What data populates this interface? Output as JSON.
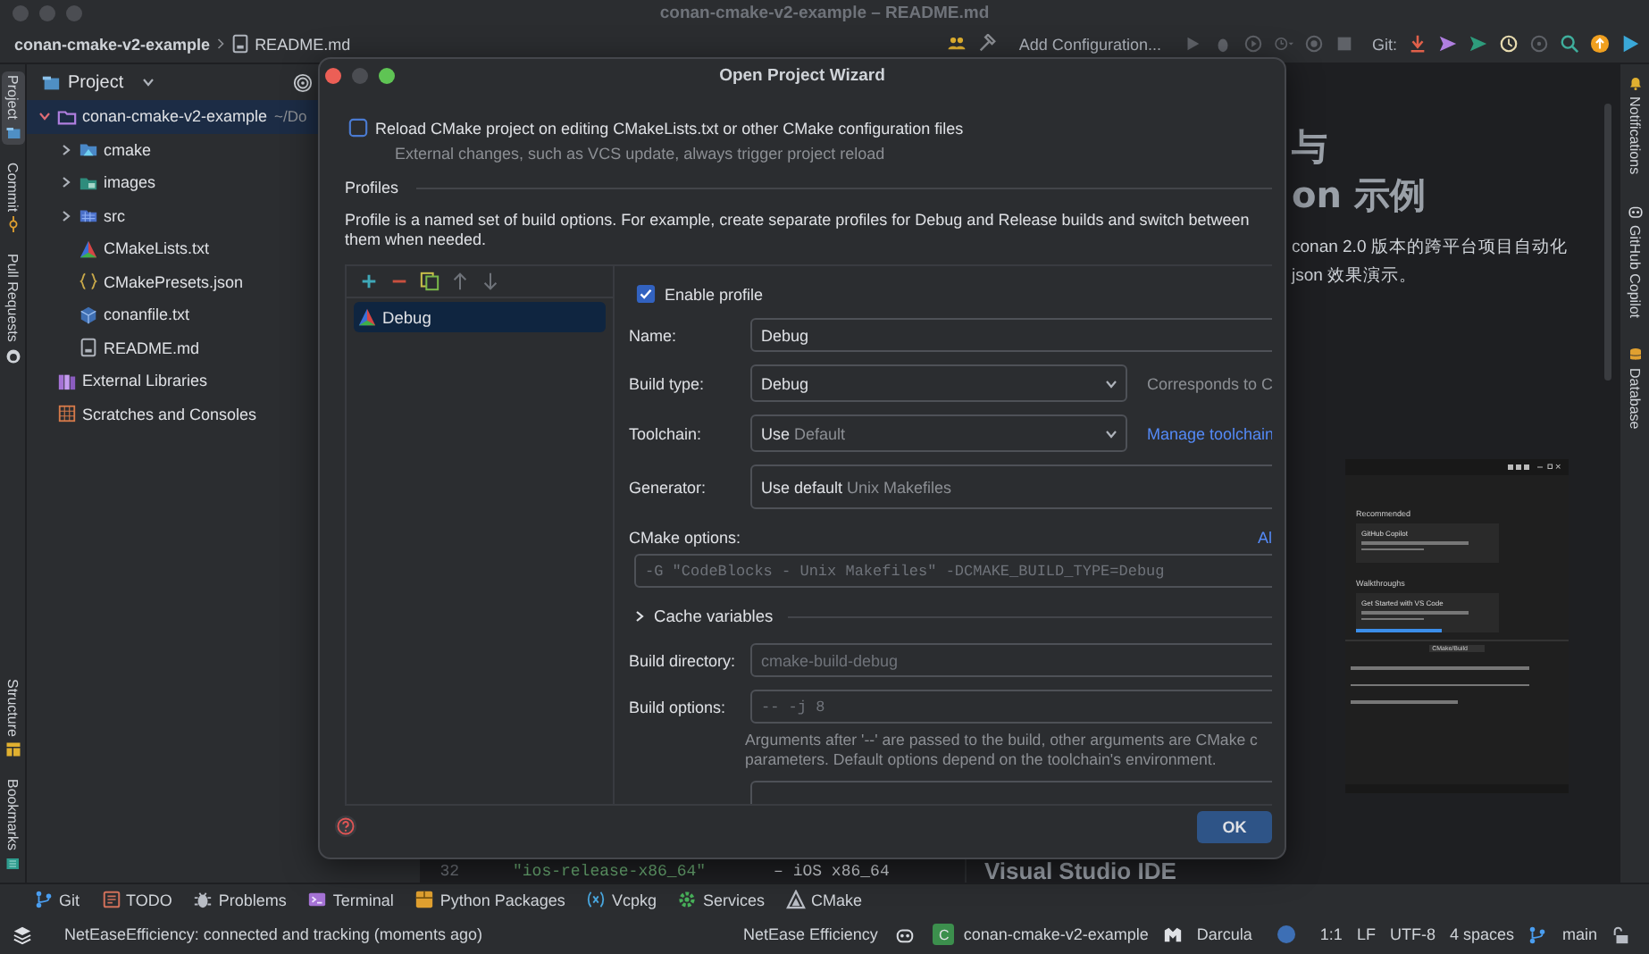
{
  "window": {
    "title": "conan-cmake-v2-example – README.md"
  },
  "breadcrumb": [
    {
      "label": "conan-cmake-v2-example",
      "kind": "project"
    },
    {
      "label": "README.md",
      "kind": "markdown"
    }
  ],
  "toolbar": {
    "run_config": "Add Configuration...",
    "git_label": "Git:"
  },
  "left_strip": [
    {
      "label": "Project",
      "kind": "project",
      "selected": true
    },
    {
      "label": "Commit",
      "kind": "commit",
      "selected": false
    },
    {
      "label": "Pull Requests",
      "kind": "github",
      "selected": false
    }
  ],
  "left_strip_bottom": [
    {
      "label": "Structure",
      "kind": "structure"
    },
    {
      "label": "Bookmarks",
      "kind": "bookmarks"
    }
  ],
  "right_strip": [
    {
      "label": "Notifications",
      "kind": "bell"
    },
    {
      "label": "GitHub Copilot",
      "kind": "copilot"
    },
    {
      "label": "Database",
      "kind": "database"
    }
  ],
  "project_panel": {
    "title": "Project",
    "tree": [
      {
        "label": "conan-cmake-v2-example",
        "detail": "~/Do",
        "kind": "root",
        "expanded": true,
        "selected": true,
        "children": [
          {
            "label": "cmake",
            "kind": "folder",
            "expanded": false,
            "selected": false
          },
          {
            "label": "images",
            "kind": "images",
            "expanded": false,
            "selected": false
          },
          {
            "label": "src",
            "kind": "source",
            "expanded": false,
            "selected": false
          },
          {
            "label": "CMakeLists.txt",
            "kind": "cmake",
            "selected": false
          },
          {
            "label": "CMakePresets.json",
            "kind": "json",
            "selected": false
          },
          {
            "label": "conanfile.txt",
            "kind": "text",
            "selected": false
          },
          {
            "label": "README.md",
            "kind": "markdown",
            "selected": false
          }
        ]
      },
      {
        "label": "External Libraries",
        "kind": "library",
        "selected": false
      },
      {
        "label": "Scratches and Consoles",
        "kind": "scratch",
        "selected": false
      }
    ]
  },
  "editor": {
    "code_line": {
      "number": "32",
      "code": "\"ios-release-x86_64\"",
      "comment": "– iOS x86_64"
    },
    "preview": {
      "heading_lines": [
        "与",
        "on 示例"
      ],
      "paragraph_lines": [
        "conan 2.0 版本的跨平台项目自动化",
        "json 效果演示。"
      ],
      "screenshot": {
        "sections": [
          {
            "title": "Recommended",
            "card": "GitHub Copilot"
          },
          {
            "title": "Walkthroughs",
            "card": "Get Started with VS Code"
          }
        ],
        "panel_dropdown": "CMake/Build"
      },
      "heading_below": "Visual Studio IDE"
    }
  },
  "dialog": {
    "title": "Open Project Wizard",
    "reload_option": {
      "label": "Reload CMake project on editing CMakeLists.txt or other CMake configuration files",
      "checked": false
    },
    "reload_hint": "External changes, such as VCS update, always trigger project reload",
    "section_title": "Profiles",
    "description": "Profile is a named set of build options. For example, create separate profiles for Debug and Release builds and switch between them when needed.",
    "profiles": [
      {
        "name": "Debug",
        "selected": true
      }
    ],
    "enable_profile": {
      "label": "Enable profile",
      "checked": true
    },
    "fields": [
      {
        "kind": "input",
        "label": "Name:",
        "value": "Debug"
      },
      {
        "kind": "select",
        "label": "Build type:",
        "value": "Debug",
        "note": "Corresponds to C"
      },
      {
        "kind": "select",
        "label": "Toolchain:",
        "value": "Use",
        "hint": "Default",
        "link": "Manage toolchain"
      },
      {
        "kind": "static",
        "label": "Generator:",
        "value": "Use default",
        "hint": "Unix Makefiles"
      },
      {
        "kind": "stacked",
        "label": "CMake options:",
        "link": "Al",
        "placeholder": "-G \"CodeBlocks - Unix Makefiles\" -DCMAKE_BUILD_TYPE=Debug"
      },
      {
        "kind": "expander",
        "label": "Cache variables",
        "expanded": false
      },
      {
        "kind": "input",
        "label": "Build directory:",
        "placeholder": "cmake-build-debug"
      },
      {
        "kind": "input",
        "label": "Build options:",
        "placeholder": "-- -j 8",
        "mono": true,
        "help_lines": [
          "Arguments after '--' are passed to the build, other arguments are CMake c",
          "parameters. Default options depend on the toolchain's environment."
        ]
      }
    ],
    "ok": "OK"
  },
  "tool_tabs": [
    {
      "label": "Git",
      "kind": "git"
    },
    {
      "label": "TODO",
      "kind": "todo"
    },
    {
      "label": "Problems",
      "kind": "problems"
    },
    {
      "label": "Terminal",
      "kind": "terminal"
    },
    {
      "label": "Python Packages",
      "kind": "packages"
    },
    {
      "label": "Vcpkg",
      "kind": "vcpkg"
    },
    {
      "label": "Services",
      "kind": "services"
    },
    {
      "label": "CMake",
      "kind": "cmake"
    }
  ],
  "status_bar": {
    "message": "NetEaseEfficiency: connected and tracking (moments ago)",
    "items": [
      {
        "kind": "text",
        "label": "NetEase Efficiency"
      },
      {
        "kind": "copilot"
      },
      {
        "kind": "project",
        "badge": "C",
        "label": "conan-cmake-v2-example"
      },
      {
        "kind": "theme",
        "label": "Darcula"
      },
      {
        "kind": "dot"
      },
      {
        "kind": "text",
        "label": "1:1"
      },
      {
        "kind": "text",
        "label": "LF"
      },
      {
        "kind": "text",
        "label": "UTF-8"
      },
      {
        "kind": "text",
        "label": "4 spaces"
      },
      {
        "kind": "branch",
        "label": "main"
      },
      {
        "kind": "lock"
      }
    ]
  }
}
